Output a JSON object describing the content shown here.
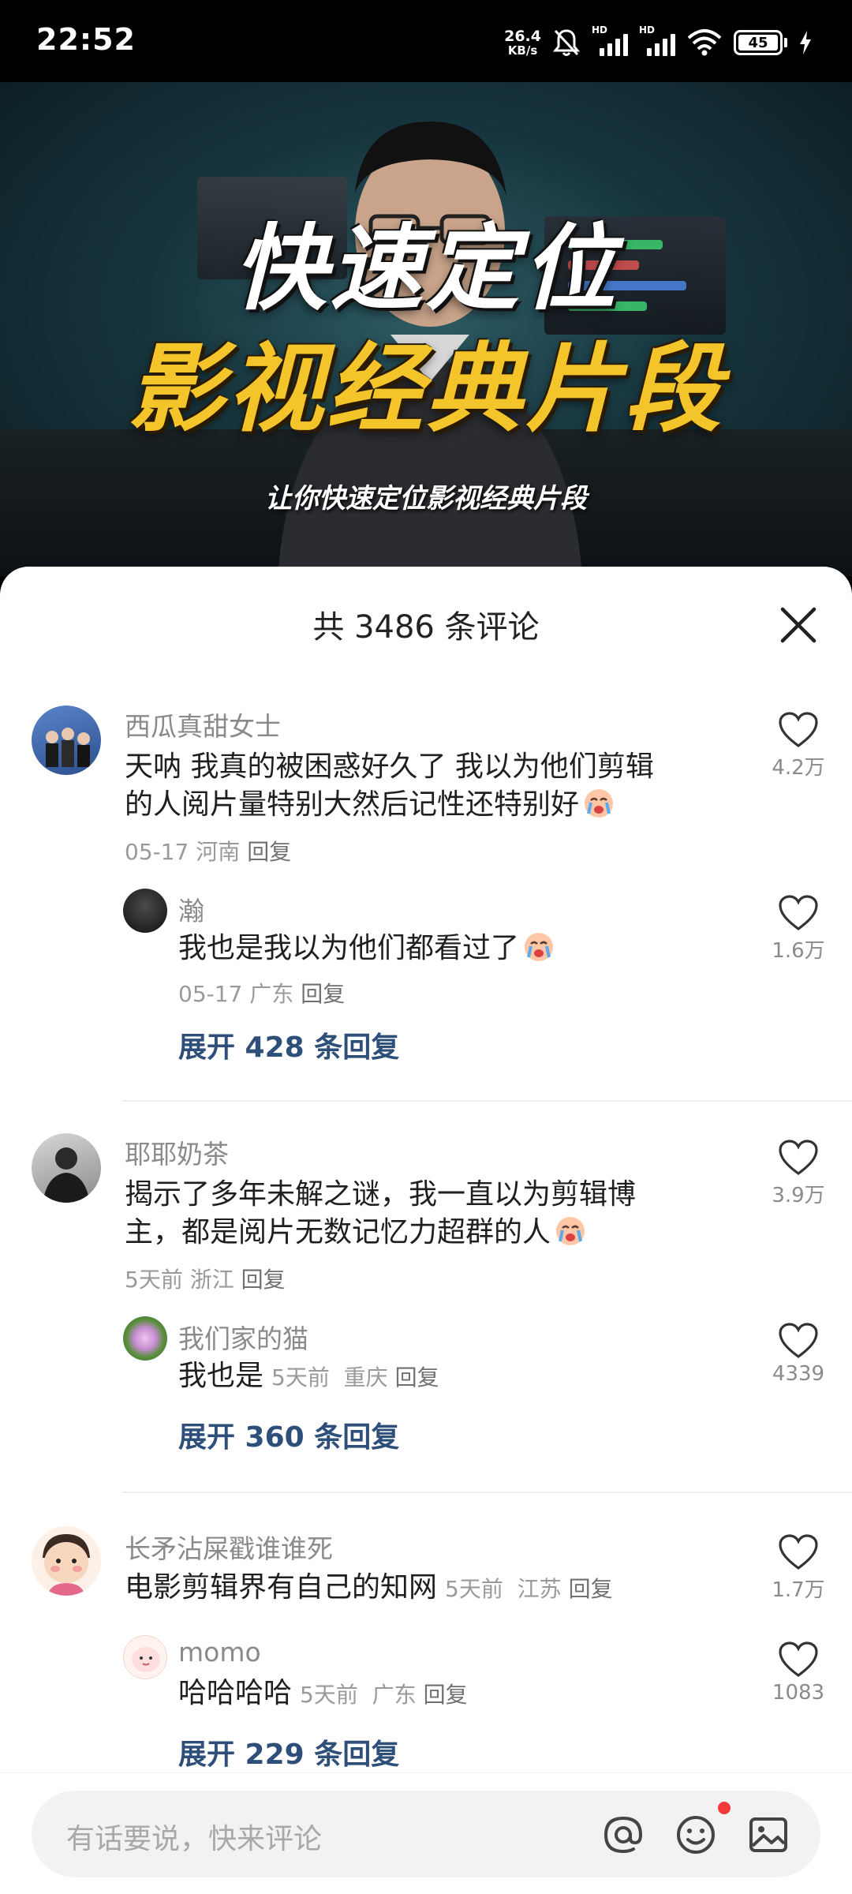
{
  "status_bar": {
    "time": "22:52",
    "net_speed": "26.4",
    "net_unit": "KB/s",
    "battery": "45",
    "icons": [
      "mute-bell-icon",
      "hd-signal-icon",
      "hd-signal-icon",
      "wifi-icon",
      "battery-icon",
      "charging-icon"
    ]
  },
  "video": {
    "title_line1": "快速定位",
    "title_line2": "影视经典片段",
    "subtitle": "让你快速定位影视经典片段"
  },
  "comments_panel": {
    "title": "共 3486 条评论",
    "comments": [
      {
        "user": "西瓜真甜女士",
        "text_line1": "天呐  我真的被困惑好久了  我以为他们剪辑",
        "text_line2": "的人阅片量特别大然后记性还特别好",
        "date": "05-17",
        "location": "河南",
        "reply_label": "回复",
        "likes": "4.2万",
        "reply": {
          "user": "瀚",
          "text": "我也是我以为他们都看过了",
          "date": "05-17",
          "location": "广东",
          "reply_label": "回复",
          "likes": "1.6万"
        },
        "expand": "展开 428 条回复"
      },
      {
        "user": "耶耶奶茶",
        "text_line1": "揭示了多年未解之谜，我一直以为剪辑博",
        "text_line2": "主，都是阅片无数记忆力超群的人",
        "date": "5天前",
        "location": "浙江",
        "reply_label": "回复",
        "likes": "3.9万",
        "reply": {
          "user": "我们家的猫",
          "text": "我也是",
          "date": "5天前",
          "location": "重庆",
          "reply_label": "回复",
          "likes": "4339"
        },
        "expand": "展开 360 条回复"
      },
      {
        "user": "长矛沾屎戳谁谁死",
        "text_line1": "电影剪辑界有自己的知网",
        "date": "5天前",
        "location": "江苏",
        "reply_label": "回复",
        "likes": "1.7万",
        "reply": {
          "user": "momo",
          "text": "哈哈哈哈",
          "date": "5天前",
          "location": "广东",
          "reply_label": "回复",
          "likes": "1083"
        },
        "expand": "展开 229 条回复"
      }
    ]
  },
  "input_bar": {
    "placeholder": "有话要说，快来评论",
    "icons": [
      "at-icon",
      "emoji-icon",
      "image-icon"
    ]
  }
}
